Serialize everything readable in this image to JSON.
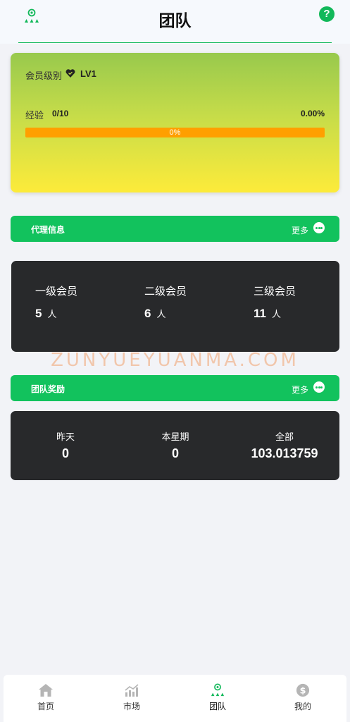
{
  "header": {
    "title": "团队"
  },
  "level": {
    "label": "会员级别",
    "value": "LV1",
    "exp_label": "经验",
    "exp_value": "0/10",
    "exp_percent": "0.00%",
    "progress_text": "0%",
    "progress_fraction": 0
  },
  "agent_section": {
    "title": "代理信息",
    "more": "更多"
  },
  "members": [
    {
      "label": "一级会员",
      "count": "5",
      "unit": "人"
    },
    {
      "label": "二级会员",
      "count": "6",
      "unit": "人"
    },
    {
      "label": "三级会员",
      "count": "11",
      "unit": "人"
    }
  ],
  "watermark": "ZUNYUEYUANMA.COM",
  "reward_section": {
    "title": "团队奖励",
    "more": "更多"
  },
  "rewards": [
    {
      "label": "昨天",
      "value": "0"
    },
    {
      "label": "本星期",
      "value": "0"
    },
    {
      "label": "全部",
      "value": "103.013759"
    }
  ],
  "nav": [
    {
      "label": "首页",
      "icon": "home-icon"
    },
    {
      "label": "市场",
      "icon": "chart-icon"
    },
    {
      "label": "团队",
      "icon": "team-icon",
      "active": true
    },
    {
      "label": "我的",
      "icon": "dollar-icon"
    }
  ],
  "colors": {
    "accent": "#12c25d",
    "card_dark": "#28292b",
    "progress": "#ff9f00",
    "nav_inactive": "#b5b5b5"
  }
}
